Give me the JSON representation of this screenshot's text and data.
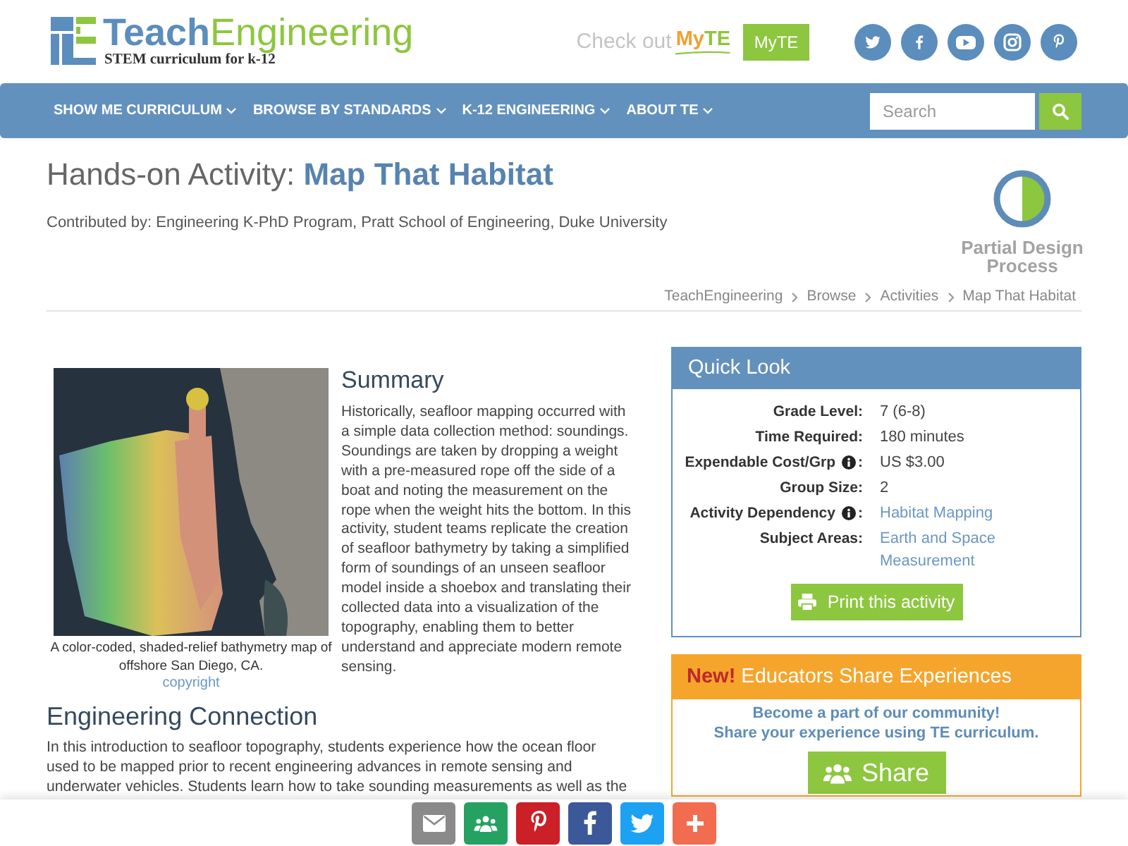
{
  "header": {
    "wordmark": [
      "Teach",
      "Engineering"
    ],
    "tagline": "STEM curriculum for k-12",
    "promo": {
      "text": "Check out",
      "logo": [
        "My",
        "TE"
      ],
      "button": "MyTE"
    }
  },
  "nav": {
    "items": [
      {
        "label": "SHOW ME CURRICULUM"
      },
      {
        "label": "BROWSE BY STANDARDS"
      },
      {
        "label": "K-12 ENGINEERING"
      },
      {
        "label": "ABOUT TE"
      }
    ],
    "search": {
      "placeholder": "Search"
    }
  },
  "page": {
    "title": [
      "Hands-on Activity:",
      "Map That Habitat"
    ],
    "contributed": "Contributed by: Engineering K-PhD Program, Pratt School of Engineering, Duke University",
    "design_process": "Partial Design Process",
    "breadcrumb": [
      "TeachEngineering",
      "Browse",
      "Activities",
      "Map That Habitat"
    ]
  },
  "figure": {
    "caption": "A color-coded, shaded-relief bathymetry map of offshore San Diego, CA.",
    "credit": "copyright"
  },
  "summary": {
    "heading": "Summary",
    "text": "Historically, seafloor mapping occurred with a simple data collection method: soundings. Soundings are taken by dropping a weight with a pre-measured rope off the side of a boat and noting the measurement on the rope when the weight hits the bottom. In this activity, student teams replicate the creation of seafloor bathymetry by taking a simplified form of soundings of an unseen seafloor model inside a shoebox and translating their collected data into a visualization of the topography, enabling them to better understand and appreciate modern remote sensing."
  },
  "engineering_connection": {
    "heading": "Engineering Connection",
    "lines": [
      "In this introduction to seafloor topography, students experience how the ocean floor",
      "used to be mapped prior to recent engineering advances in remote sensing and",
      "underwater vehicles. Students learn how to take sounding measurements as well as the"
    ]
  },
  "quick_look": {
    "title": "Quick Look",
    "rows": [
      {
        "label": "Grade Level:",
        "info": false,
        "kind": "text",
        "values": [
          "7 (6-8)"
        ]
      },
      {
        "label": "Time Required:",
        "info": false,
        "kind": "text",
        "values": [
          "180 minutes"
        ]
      },
      {
        "label": "Expendable Cost/Grp",
        "info": true,
        "suffix": ":",
        "kind": "text",
        "values": [
          "US $3.00"
        ]
      },
      {
        "label": "Group Size:",
        "info": false,
        "kind": "text",
        "values": [
          "2"
        ]
      },
      {
        "label": "Activity Dependency",
        "info": true,
        "suffix": ":",
        "kind": "link",
        "values": [
          "Habitat Mapping"
        ]
      },
      {
        "label": "Subject Areas:",
        "info": false,
        "kind": "link",
        "values": [
          "Earth and Space",
          "Measurement"
        ]
      }
    ],
    "button": "Print this activity"
  },
  "educators": {
    "heading": "**New!** Educators Share Experiences",
    "lines": [
      "Become a part of our community!",
      "Share your experience using TE curriculum."
    ],
    "button": "Share"
  }
}
